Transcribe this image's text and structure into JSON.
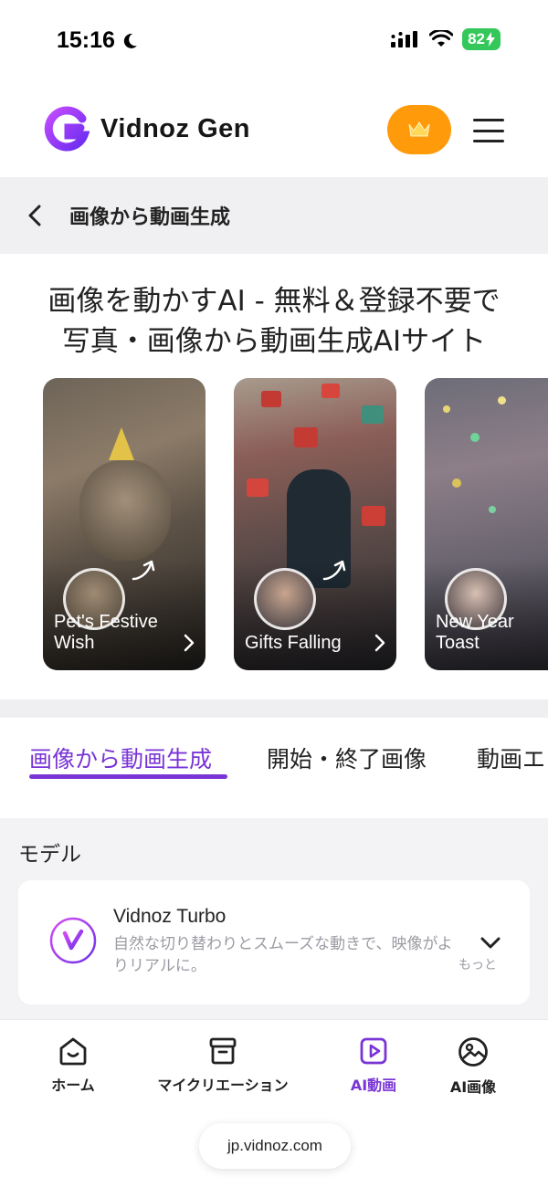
{
  "status_bar": {
    "time": "15:16",
    "battery": "82"
  },
  "header": {
    "brand": "Vidnoz Gen"
  },
  "sub_bar": {
    "title": "画像から動画生成"
  },
  "hero": {
    "line1": "画像を動かすAI - 無料＆登録不要で",
    "line2": "写真・画像から動画生成AIサイト"
  },
  "cards": [
    {
      "label_line1": "Pet's Festive",
      "label_line2": "Wish"
    },
    {
      "label_line1": "Gifts Falling",
      "label_line2": ""
    },
    {
      "label_line1": "New Year",
      "label_line2": "Toast"
    }
  ],
  "tabs": [
    {
      "label": "画像から動画生成",
      "active": true
    },
    {
      "label": "開始・終了画像",
      "active": false
    },
    {
      "label": "動画エ",
      "active": false
    }
  ],
  "model": {
    "heading": "モデル",
    "name": "Vidnoz Turbo",
    "description": "自然な切り替わりとスムーズな動きで、映像がよりリアルに。",
    "more": "もっと"
  },
  "bottom_nav": [
    {
      "label": "ホーム",
      "icon": "home-icon"
    },
    {
      "label": "マイクリエーション",
      "icon": "archive-box-icon"
    },
    {
      "label": "AI動画",
      "icon": "video-play-icon"
    },
    {
      "label": "AI画像",
      "icon": "image-icon"
    }
  ],
  "browser": {
    "url": "jp.vidnoz.com"
  },
  "colors": {
    "accent": "#7a35d6",
    "crown_button": "#ff9a0a",
    "battery": "#34c759"
  }
}
